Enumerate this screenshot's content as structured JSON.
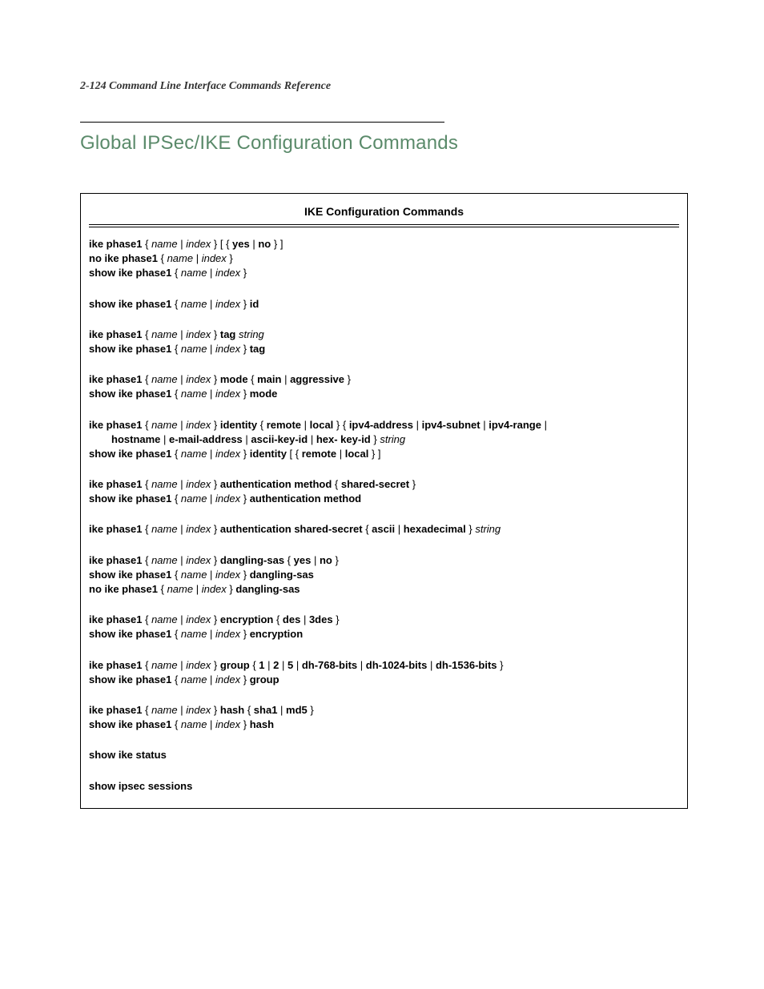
{
  "header": "2-124  Command Line Interface Commands Reference",
  "section_title": "Global IPSec/IKE Configuration Commands",
  "box_title": "IKE Configuration Commands",
  "blocks": [
    {
      "lines": [
        [
          {
            "t": "ike phase1",
            "b": true
          },
          {
            "t": " { "
          },
          {
            "t": "name",
            "i": true
          },
          {
            "t": " | "
          },
          {
            "t": "index",
            "i": true
          },
          {
            "t": " } [ { "
          },
          {
            "t": "yes",
            "b": true
          },
          {
            "t": " | "
          },
          {
            "t": "no",
            "b": true
          },
          {
            "t": " } ]"
          }
        ],
        [
          {
            "t": "no ike phase1",
            "b": true
          },
          {
            "t": " { "
          },
          {
            "t": "name",
            "i": true
          },
          {
            "t": " | "
          },
          {
            "t": "index",
            "i": true
          },
          {
            "t": " }"
          }
        ],
        [
          {
            "t": "show ike phase1",
            "b": true
          },
          {
            "t": " { "
          },
          {
            "t": "name",
            "i": true
          },
          {
            "t": " | "
          },
          {
            "t": "index",
            "i": true
          },
          {
            "t": " }"
          }
        ]
      ]
    },
    {
      "lines": [
        [
          {
            "t": "show ike phase1",
            "b": true
          },
          {
            "t": " { "
          },
          {
            "t": "name",
            "i": true
          },
          {
            "t": " | "
          },
          {
            "t": "index",
            "i": true
          },
          {
            "t": " } "
          },
          {
            "t": "id",
            "b": true
          }
        ]
      ]
    },
    {
      "lines": [
        [
          {
            "t": "ike phase1",
            "b": true
          },
          {
            "t": " { "
          },
          {
            "t": "name",
            "i": true
          },
          {
            "t": " | "
          },
          {
            "t": "index",
            "i": true
          },
          {
            "t": " } "
          },
          {
            "t": "tag",
            "b": true
          },
          {
            "t": " "
          },
          {
            "t": "string",
            "i": true
          }
        ],
        [
          {
            "t": "show ike phase1",
            "b": true
          },
          {
            "t": " { "
          },
          {
            "t": "name",
            "i": true
          },
          {
            "t": " | "
          },
          {
            "t": "index",
            "i": true
          },
          {
            "t": " } "
          },
          {
            "t": "tag",
            "b": true
          }
        ]
      ]
    },
    {
      "lines": [
        [
          {
            "t": "ike phase1",
            "b": true
          },
          {
            "t": " { "
          },
          {
            "t": "name",
            "i": true
          },
          {
            "t": " | "
          },
          {
            "t": "index",
            "i": true
          },
          {
            "t": " } "
          },
          {
            "t": "mode",
            "b": true
          },
          {
            "t": " { "
          },
          {
            "t": "main",
            "b": true
          },
          {
            "t": " | "
          },
          {
            "t": "aggressive",
            "b": true
          },
          {
            "t": " }"
          }
        ],
        [
          {
            "t": "show ike phase1",
            "b": true
          },
          {
            "t": " { "
          },
          {
            "t": "name",
            "i": true
          },
          {
            "t": " | "
          },
          {
            "t": "index",
            "i": true
          },
          {
            "t": " } "
          },
          {
            "t": "mode",
            "b": true
          }
        ]
      ]
    },
    {
      "lines": [
        [
          {
            "t": "ike phase1",
            "b": true
          },
          {
            "t": " { "
          },
          {
            "t": "name",
            "i": true
          },
          {
            "t": " | "
          },
          {
            "t": "index",
            "i": true
          },
          {
            "t": " } "
          },
          {
            "t": "identity",
            "b": true
          },
          {
            "t": " { "
          },
          {
            "t": "remote",
            "b": true
          },
          {
            "t": " | "
          },
          {
            "t": "local",
            "b": true
          },
          {
            "t": " } { "
          },
          {
            "t": "ipv4-address",
            "b": true
          },
          {
            "t": "  | "
          },
          {
            "t": "ipv4-subnet",
            "b": true
          },
          {
            "t": " | "
          },
          {
            "t": "ipv4-range",
            "b": true
          },
          {
            "t": " |"
          }
        ],
        [
          {
            "indent": true,
            "t": ""
          },
          {
            "t": "hostname",
            "b": true
          },
          {
            "t": " | "
          },
          {
            "t": "e-mail-address",
            "b": true
          },
          {
            "t": "  | "
          },
          {
            "t": "ascii-key-id",
            "b": true
          },
          {
            "t": " | "
          },
          {
            "t": "hex- key-id",
            "b": true
          },
          {
            "t": " } "
          },
          {
            "t": "string",
            "i": true
          }
        ],
        [
          {
            "t": "show ike phase1",
            "b": true
          },
          {
            "t": " { "
          },
          {
            "t": "name",
            "i": true
          },
          {
            "t": " | "
          },
          {
            "t": "index",
            "i": true
          },
          {
            "t": " } "
          },
          {
            "t": "identity",
            "b": true
          },
          {
            "t": " [ { "
          },
          {
            "t": "remote",
            "b": true
          },
          {
            "t": " | "
          },
          {
            "t": "local",
            "b": true
          },
          {
            "t": " } ]"
          }
        ]
      ]
    },
    {
      "lines": [
        [
          {
            "t": "ike phase1",
            "b": true
          },
          {
            "t": " { "
          },
          {
            "t": "name",
            "i": true
          },
          {
            "t": " | "
          },
          {
            "t": "index",
            "i": true
          },
          {
            "t": " } "
          },
          {
            "t": "authentication method",
            "b": true
          },
          {
            "t": " { "
          },
          {
            "t": "shared-secret",
            "b": true
          },
          {
            "t": " }"
          }
        ],
        [
          {
            "t": "show ike phase1",
            "b": true
          },
          {
            "t": " { "
          },
          {
            "t": "name",
            "i": true
          },
          {
            "t": " | "
          },
          {
            "t": "index",
            "i": true
          },
          {
            "t": " } "
          },
          {
            "t": "authentication method",
            "b": true
          }
        ]
      ]
    },
    {
      "lines": [
        [
          {
            "t": "ike phase1",
            "b": true
          },
          {
            "t": " { "
          },
          {
            "t": "name",
            "i": true
          },
          {
            "t": " | "
          },
          {
            "t": "index",
            "i": true
          },
          {
            "t": " } "
          },
          {
            "t": "authentication shared-secret",
            "b": true
          },
          {
            "t": " { "
          },
          {
            "t": "ascii",
            "b": true
          },
          {
            "t": " | "
          },
          {
            "t": "hexadecimal",
            "b": true
          },
          {
            "t": " } "
          },
          {
            "t": "string",
            "i": true
          }
        ]
      ]
    },
    {
      "lines": [
        [
          {
            "t": "ike phase1",
            "b": true
          },
          {
            "t": " { "
          },
          {
            "t": "name",
            "i": true
          },
          {
            "t": " | "
          },
          {
            "t": "index",
            "i": true
          },
          {
            "t": " } "
          },
          {
            "t": "dangling-sas",
            "b": true
          },
          {
            "t": " { "
          },
          {
            "t": "yes",
            "b": true
          },
          {
            "t": " | "
          },
          {
            "t": "no",
            "b": true
          },
          {
            "t": " }"
          }
        ],
        [
          {
            "t": "show ike phase1",
            "b": true
          },
          {
            "t": " { "
          },
          {
            "t": "name",
            "i": true
          },
          {
            "t": " | "
          },
          {
            "t": "index",
            "i": true
          },
          {
            "t": " } "
          },
          {
            "t": "dangling-sas",
            "b": true
          }
        ],
        [
          {
            "t": "no ike phase1",
            "b": true
          },
          {
            "t": " { "
          },
          {
            "t": "name",
            "i": true
          },
          {
            "t": " | "
          },
          {
            "t": "index",
            "i": true
          },
          {
            "t": " } "
          },
          {
            "t": "dangling-sas",
            "b": true
          }
        ]
      ]
    },
    {
      "lines": [
        [
          {
            "t": "ike phase1",
            "b": true
          },
          {
            "t": " { "
          },
          {
            "t": "name",
            "i": true
          },
          {
            "t": " | "
          },
          {
            "t": "index",
            "i": true
          },
          {
            "t": " } "
          },
          {
            "t": "encryption",
            "b": true
          },
          {
            "t": " { "
          },
          {
            "t": "des",
            "b": true
          },
          {
            "t": " | "
          },
          {
            "t": "3des",
            "b": true
          },
          {
            "t": " }"
          }
        ],
        [
          {
            "t": "show ike phase1",
            "b": true
          },
          {
            "t": " { "
          },
          {
            "t": "name",
            "i": true
          },
          {
            "t": " | "
          },
          {
            "t": "index",
            "i": true
          },
          {
            "t": " } "
          },
          {
            "t": "encryption",
            "b": true
          }
        ]
      ]
    },
    {
      "lines": [
        [
          {
            "t": "ike phase1",
            "b": true
          },
          {
            "t": " { "
          },
          {
            "t": "name",
            "i": true
          },
          {
            "t": " | "
          },
          {
            "t": "index",
            "i": true
          },
          {
            "t": " } "
          },
          {
            "t": "group",
            "b": true
          },
          {
            "t": " { "
          },
          {
            "t": "1",
            "b": true
          },
          {
            "t": " | "
          },
          {
            "t": "2",
            "b": true
          },
          {
            "t": " | "
          },
          {
            "t": "5",
            "b": true
          },
          {
            "t": " | "
          },
          {
            "t": "dh-768-bits",
            "b": true
          },
          {
            "t": " | "
          },
          {
            "t": "dh-1024-bits",
            "b": true
          },
          {
            "t": " | "
          },
          {
            "t": "dh-1536-bits",
            "b": true
          },
          {
            "t": " }"
          }
        ],
        [
          {
            "t": "show ike phase1",
            "b": true
          },
          {
            "t": " { "
          },
          {
            "t": "name",
            "i": true
          },
          {
            "t": " | "
          },
          {
            "t": "index",
            "i": true
          },
          {
            "t": " } "
          },
          {
            "t": "group",
            "b": true
          }
        ]
      ]
    },
    {
      "lines": [
        [
          {
            "t": "ike phase1",
            "b": true
          },
          {
            "t": " { "
          },
          {
            "t": "name",
            "i": true
          },
          {
            "t": " | "
          },
          {
            "t": "index",
            "i": true
          },
          {
            "t": " } "
          },
          {
            "t": "hash",
            "b": true
          },
          {
            "t": " { "
          },
          {
            "t": "sha1",
            "b": true
          },
          {
            "t": " | "
          },
          {
            "t": "md5",
            "b": true
          },
          {
            "t": " }"
          }
        ],
        [
          {
            "t": "show ike phase1",
            "b": true
          },
          {
            "t": " { "
          },
          {
            "t": "name",
            "i": true
          },
          {
            "t": " | "
          },
          {
            "t": "index",
            "i": true
          },
          {
            "t": " } "
          },
          {
            "t": "hash",
            "b": true
          }
        ]
      ]
    },
    {
      "lines": [
        [
          {
            "t": "show ike status",
            "b": true
          }
        ]
      ]
    },
    {
      "lines": [
        [
          {
            "t": "show ipsec sessions",
            "b": true
          }
        ]
      ]
    }
  ]
}
